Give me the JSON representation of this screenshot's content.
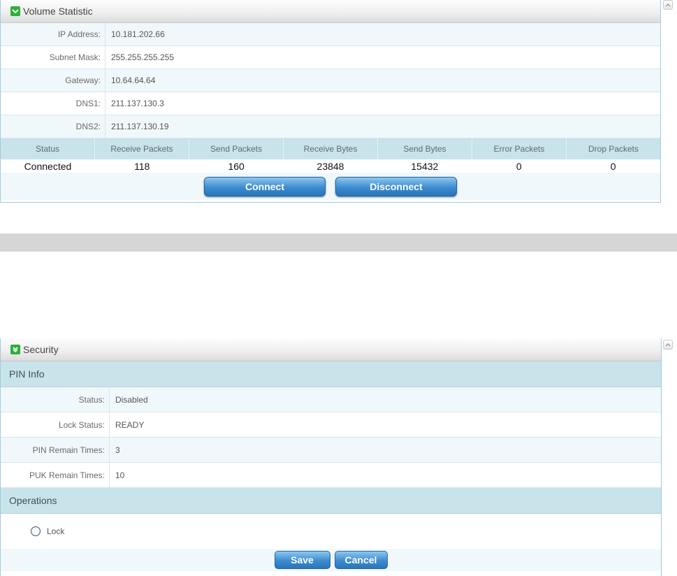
{
  "volume": {
    "title": "Volume Statistic",
    "rows": [
      {
        "label": "IP Address:",
        "value": "10.181.202.66"
      },
      {
        "label": "Subnet Mask:",
        "value": "255.255.255.255"
      },
      {
        "label": "Gateway:",
        "value": "10.64.64.64"
      },
      {
        "label": "DNS1:",
        "value": "211.137.130.3"
      },
      {
        "label": "DNS2:",
        "value": "211.137.130.19"
      }
    ],
    "stats": {
      "headers": [
        "Status",
        "Receive Packets",
        "Send Packets",
        "Receive Bytes",
        "Send Bytes",
        "Error Packets",
        "Drop Packets"
      ],
      "values": [
        "Connected",
        "118",
        "160",
        "23848",
        "15432",
        "0",
        "0"
      ]
    },
    "connect_label": "Connect",
    "disconnect_label": "Disconnect"
  },
  "security": {
    "title": "Security",
    "pin_info_title": "PIN Info",
    "rows": [
      {
        "label": "Status:",
        "value": "Disabled"
      },
      {
        "label": "Lock Status:",
        "value": "READY"
      },
      {
        "label": "PIN Remain Times:",
        "value": "3"
      },
      {
        "label": "PUK Remain Times:",
        "value": "10"
      }
    ],
    "operations_title": "Operations",
    "lock_label": "Lock",
    "save_label": "Save",
    "cancel_label": "Cancel"
  },
  "colors": {
    "accent_blue": "#3c8bd0",
    "header_green": "#2fae3a",
    "table_header": "#c8e3ea"
  }
}
